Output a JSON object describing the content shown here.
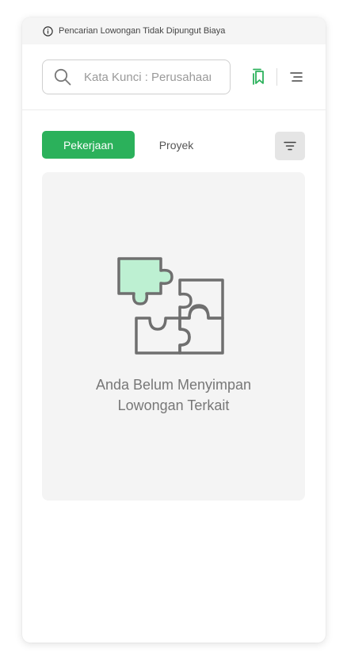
{
  "notice": {
    "text": "Pencarian Lowongan Tidak Dipungut Biaya"
  },
  "search": {
    "placeholder": "Kata Kunci : Perusahaan, Posisi"
  },
  "tabs": [
    {
      "label": "Pekerjaan",
      "active": true
    },
    {
      "label": "Proyek",
      "active": false
    }
  ],
  "empty_state": {
    "line1": "Anda Belum Menyimpan",
    "line2": "Lowongan Terkait"
  },
  "colors": {
    "accent": "#2bb15b",
    "puzzle_highlight": "#bdf0d2",
    "puzzle_stroke": "#6f6f6f"
  }
}
